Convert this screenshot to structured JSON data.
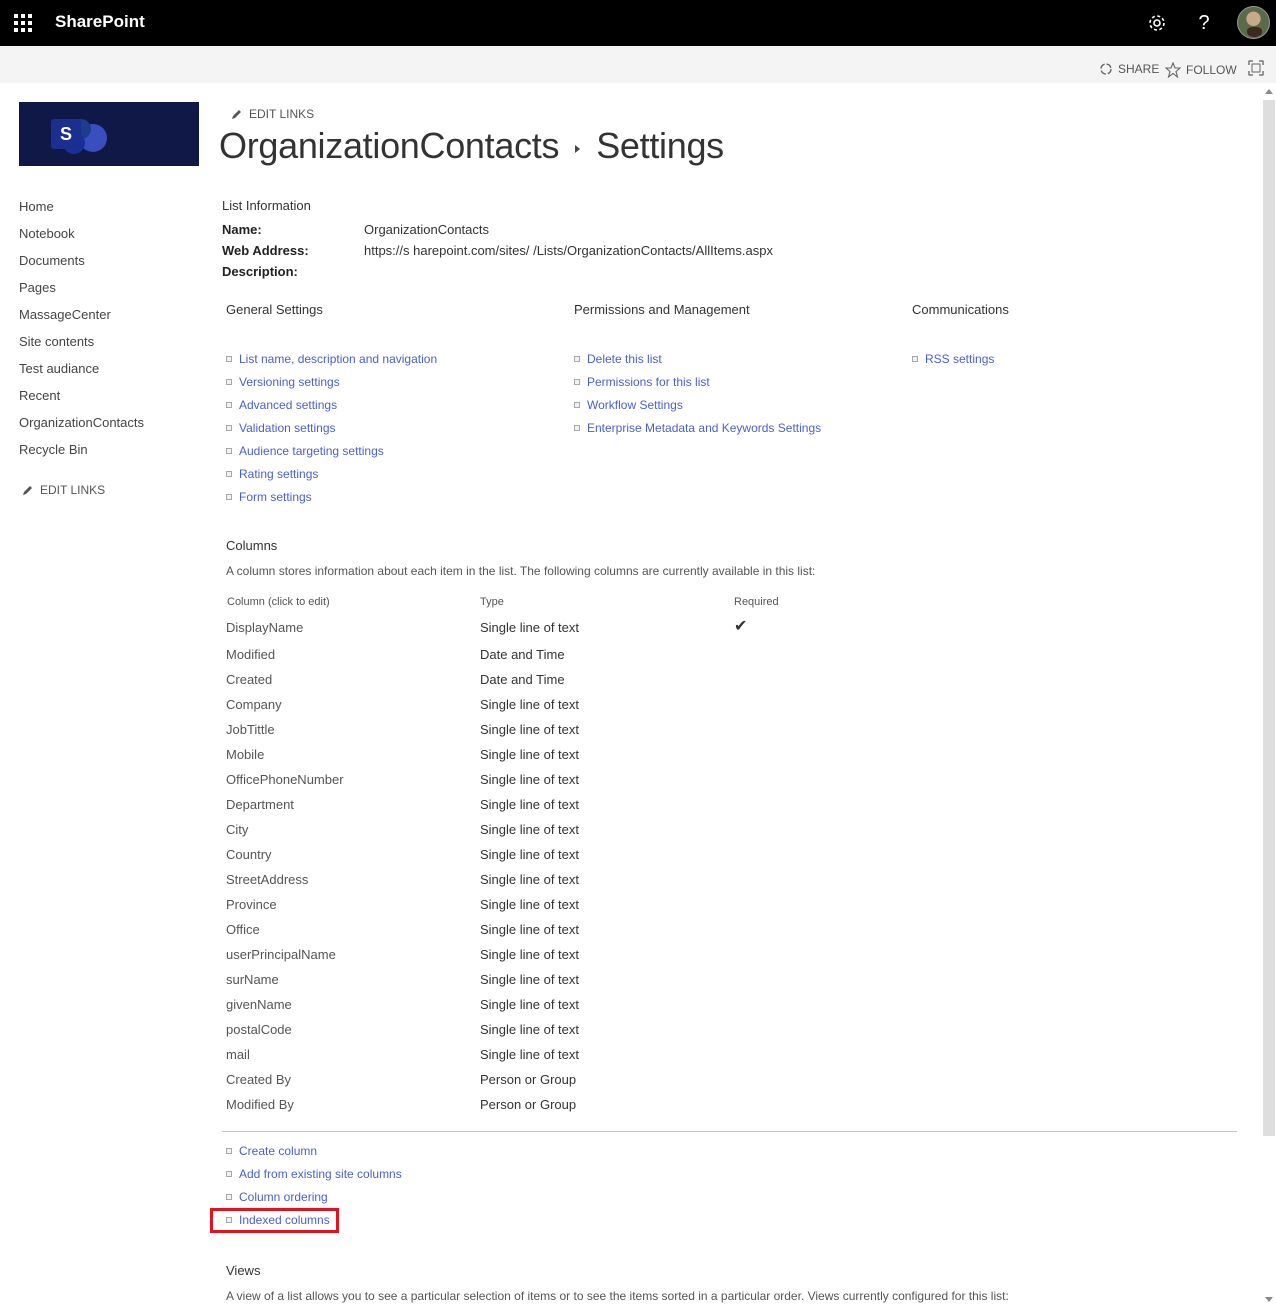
{
  "suitebar": {
    "brand": "SharePoint",
    "icons": [
      "waffle-icon",
      "gear-icon",
      "help-icon",
      "avatar"
    ]
  },
  "actionbar": {
    "share_label": "SHARE",
    "follow_label": "FOLLOW"
  },
  "logo": {
    "letter": "S"
  },
  "leftnav": {
    "items": [
      "Home",
      "Notebook",
      "Documents",
      "Pages",
      "MassageCenter",
      "Site contents",
      "Test audiance",
      "Recent",
      "OrganizationContacts",
      "Recycle Bin"
    ],
    "edit_links_label": "EDIT LINKS"
  },
  "top_edit_links_label": "EDIT LINKS",
  "title": {
    "list_name": "OrganizationContacts",
    "page": "Settings"
  },
  "list_info": {
    "heading": "List Information",
    "name_label": "Name:",
    "name_value": "OrganizationContacts",
    "web_address_label": "Web Address:",
    "web_address_value": "https://s              harepoint.com/sites/              /Lists/OrganizationContacts/AllItems.aspx",
    "description_label": "Description:"
  },
  "general_settings": {
    "heading": "General Settings",
    "links": [
      "List name, description and navigation",
      "Versioning settings",
      "Advanced settings",
      "Validation settings",
      "Audience targeting settings",
      "Rating settings",
      "Form settings"
    ]
  },
  "permissions": {
    "heading": "Permissions and Management",
    "links": [
      "Delete this list",
      "Permissions for this list",
      "Workflow Settings",
      "Enterprise Metadata and Keywords Settings"
    ]
  },
  "communications": {
    "heading": "Communications",
    "links": [
      "RSS settings"
    ]
  },
  "columns": {
    "heading": "Columns",
    "description": "A column stores information about each item in the list. The following columns are currently available in this list:",
    "header_column": "Column (click to edit)",
    "header_type": "Type",
    "header_required": "Required",
    "rows": [
      {
        "name": "DisplayName",
        "type": "Single line of text",
        "required": "✔"
      },
      {
        "name": "Modified",
        "type": "Date and Time",
        "required": ""
      },
      {
        "name": "Created",
        "type": "Date and Time",
        "required": ""
      },
      {
        "name": "Company",
        "type": "Single line of text",
        "required": ""
      },
      {
        "name": "JobTittle",
        "type": "Single line of text",
        "required": ""
      },
      {
        "name": "Mobile",
        "type": "Single line of text",
        "required": ""
      },
      {
        "name": "OfficePhoneNumber",
        "type": "Single line of text",
        "required": ""
      },
      {
        "name": "Department",
        "type": "Single line of text",
        "required": ""
      },
      {
        "name": "City",
        "type": "Single line of text",
        "required": ""
      },
      {
        "name": "Country",
        "type": "Single line of text",
        "required": ""
      },
      {
        "name": "StreetAddress",
        "type": "Single line of text",
        "required": ""
      },
      {
        "name": "Province",
        "type": "Single line of text",
        "required": ""
      },
      {
        "name": "Office",
        "type": "Single line of text",
        "required": ""
      },
      {
        "name": "userPrincipalName",
        "type": "Single line of text",
        "required": ""
      },
      {
        "name": "surName",
        "type": "Single line of text",
        "required": ""
      },
      {
        "name": "givenName",
        "type": "Single line of text",
        "required": ""
      },
      {
        "name": "postalCode",
        "type": "Single line of text",
        "required": ""
      },
      {
        "name": "mail",
        "type": "Single line of text",
        "required": ""
      },
      {
        "name": "Created By",
        "type": "Person or Group",
        "required": ""
      },
      {
        "name": "Modified By",
        "type": "Person or Group",
        "required": ""
      }
    ],
    "links": [
      "Create column",
      "Add from existing site columns",
      "Column ordering",
      "Indexed columns"
    ]
  },
  "views": {
    "heading": "Views",
    "description": "A view of a list allows you to see a particular selection of items or to see the items sorted in a particular order. Views currently configured for this list:"
  },
  "colors": {
    "suitebar": "#000000",
    "link": "#4a5fcf",
    "highlight": "#e0141e",
    "logo_bg": "#101848"
  }
}
